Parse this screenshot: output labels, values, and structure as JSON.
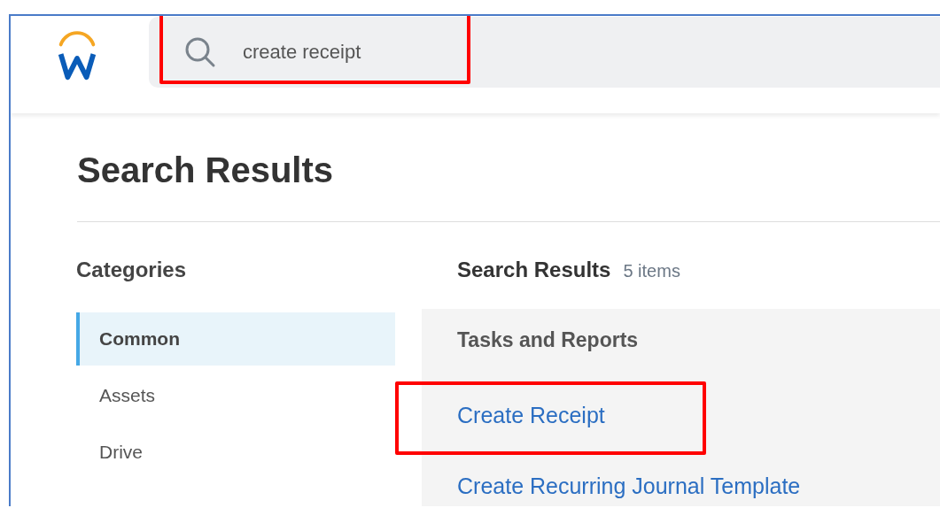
{
  "search": {
    "value": "create receipt",
    "annotated": true
  },
  "page_title": "Search Results",
  "categories": {
    "title": "Categories",
    "items": [
      {
        "label": "Common",
        "selected": true
      },
      {
        "label": "Assets",
        "selected": false
      },
      {
        "label": "Drive",
        "selected": false
      }
    ]
  },
  "results": {
    "title": "Search Results",
    "count": "5 items",
    "group": "Tasks and Reports",
    "items": [
      {
        "label": "Create Receipt",
        "annotated": true
      },
      {
        "label": "Create Recurring Journal Template",
        "annotated": false
      }
    ]
  }
}
